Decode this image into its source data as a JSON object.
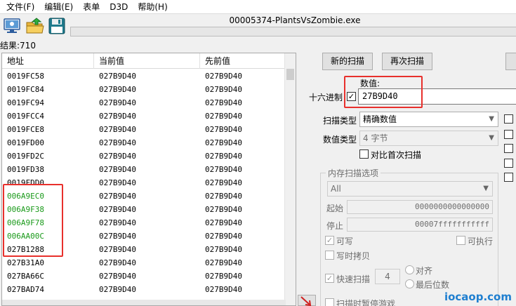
{
  "menu": [
    "文件(F)",
    "编辑(E)",
    "表单",
    "D3D",
    "帮助(H)"
  ],
  "process_title": "00005374-PlantsVsZombie.exe",
  "results_label": "结果:710",
  "list": {
    "headers": [
      "地址",
      "当前值",
      "先前值"
    ],
    "rows": [
      {
        "address": "0019FC58",
        "current": "027B9D40",
        "previous": "027B9D40",
        "green": false
      },
      {
        "address": "0019FC84",
        "current": "027B9D40",
        "previous": "027B9D40",
        "green": false
      },
      {
        "address": "0019FC94",
        "current": "027B9D40",
        "previous": "027B9D40",
        "green": false
      },
      {
        "address": "0019FCC4",
        "current": "027B9D40",
        "previous": "027B9D40",
        "green": false
      },
      {
        "address": "0019FCE8",
        "current": "027B9D40",
        "previous": "027B9D40",
        "green": false
      },
      {
        "address": "0019FD00",
        "current": "027B9D40",
        "previous": "027B9D40",
        "green": false
      },
      {
        "address": "0019FD2C",
        "current": "027B9D40",
        "previous": "027B9D40",
        "green": false
      },
      {
        "address": "0019FD38",
        "current": "027B9D40",
        "previous": "027B9D40",
        "green": false
      },
      {
        "address": "0019FDD0",
        "current": "027B9D40",
        "previous": "027B9D40",
        "green": false
      },
      {
        "address": "006A9EC0",
        "current": "027B9D40",
        "previous": "027B9D40",
        "green": true
      },
      {
        "address": "006A9F38",
        "current": "027B9D40",
        "previous": "027B9D40",
        "green": true
      },
      {
        "address": "006A9F78",
        "current": "027B9D40",
        "previous": "027B9D40",
        "green": true
      },
      {
        "address": "006AA00C",
        "current": "027B9D40",
        "previous": "027B9D40",
        "green": true
      },
      {
        "address": "027B1288",
        "current": "027B9D40",
        "previous": "027B9D40",
        "green": false
      },
      {
        "address": "027B31A0",
        "current": "027B9D40",
        "previous": "027B9D40",
        "green": false
      },
      {
        "address": "027BA66C",
        "current": "027B9D40",
        "previous": "027B9D40",
        "green": false
      },
      {
        "address": "027BAD74",
        "current": "027B9D40",
        "previous": "027B9D40",
        "green": false
      }
    ]
  },
  "buttons": {
    "new_scan": "新的扫描",
    "next_scan": "再次扫描"
  },
  "value": {
    "label": "数值:",
    "hex_label": "十六进制",
    "hex_checked": true,
    "input": "27B9D40"
  },
  "scan_type": {
    "label": "扫描类型",
    "selected": "精确数值"
  },
  "value_type": {
    "label": "数值类型",
    "selected": "4 字节"
  },
  "compare_first": {
    "label": "对比首次扫描",
    "checked": false
  },
  "memory_options": {
    "title": "内存扫描选项",
    "region": "All",
    "start_label": "起始",
    "start_value": "0000000000000000",
    "stop_label": "停止",
    "stop_value": "00007fffffffffff",
    "writable": "可写",
    "executable": "可执行",
    "copy_on_write": "写时拷贝",
    "fast_scan": "快速扫描",
    "fast_scan_value": "4",
    "align": "对齐",
    "last_digits": "最后位数",
    "pause_game": "扫描时暂停游戏"
  },
  "watermark": "iocaop.com",
  "colors": {
    "highlight": "#e8302c",
    "green_text": "#1a9a1a",
    "progress": "#06b025"
  }
}
